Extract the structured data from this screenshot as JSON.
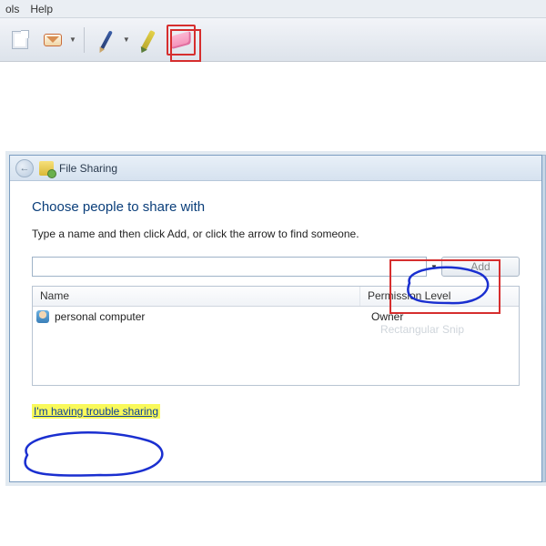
{
  "menubar": {
    "items": [
      "ols",
      "Help"
    ]
  },
  "toolbar": {
    "selected_tool": "eraser"
  },
  "dialog": {
    "title": "File Sharing",
    "heading": "Choose people to share with",
    "subtitle": "Type a name and then click Add, or click the arrow to find someone.",
    "add_label": "Add",
    "columns": {
      "name": "Name",
      "permission": "Permission Level"
    },
    "rows": [
      {
        "name": "personal computer",
        "permission": "Owner"
      }
    ],
    "watermark": "Rectangular Snip",
    "trouble_link": "I'm having trouble sharing"
  }
}
